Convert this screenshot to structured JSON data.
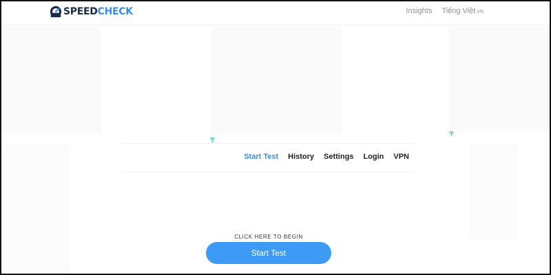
{
  "header": {
    "logo": {
      "part1": "SPEED",
      "part2": "CHECK"
    },
    "nav": {
      "insights": "Insights",
      "language": "Tiếng Việt",
      "language_code": "VN"
    }
  },
  "subnav": {
    "items": [
      "Start Test",
      "History",
      "Settings",
      "Login",
      "VPN"
    ]
  },
  "cta": {
    "label": "CLICK HERE TO BEGIN",
    "button": "Start Test"
  },
  "colors": {
    "accent": "#3a8ee6",
    "button": "#3d9af5",
    "logo_dark": "#1b2a4a",
    "wifi": "#2ecc8f"
  },
  "icons": [
    "speedometer-logo-icon",
    "wifi-icon"
  ]
}
